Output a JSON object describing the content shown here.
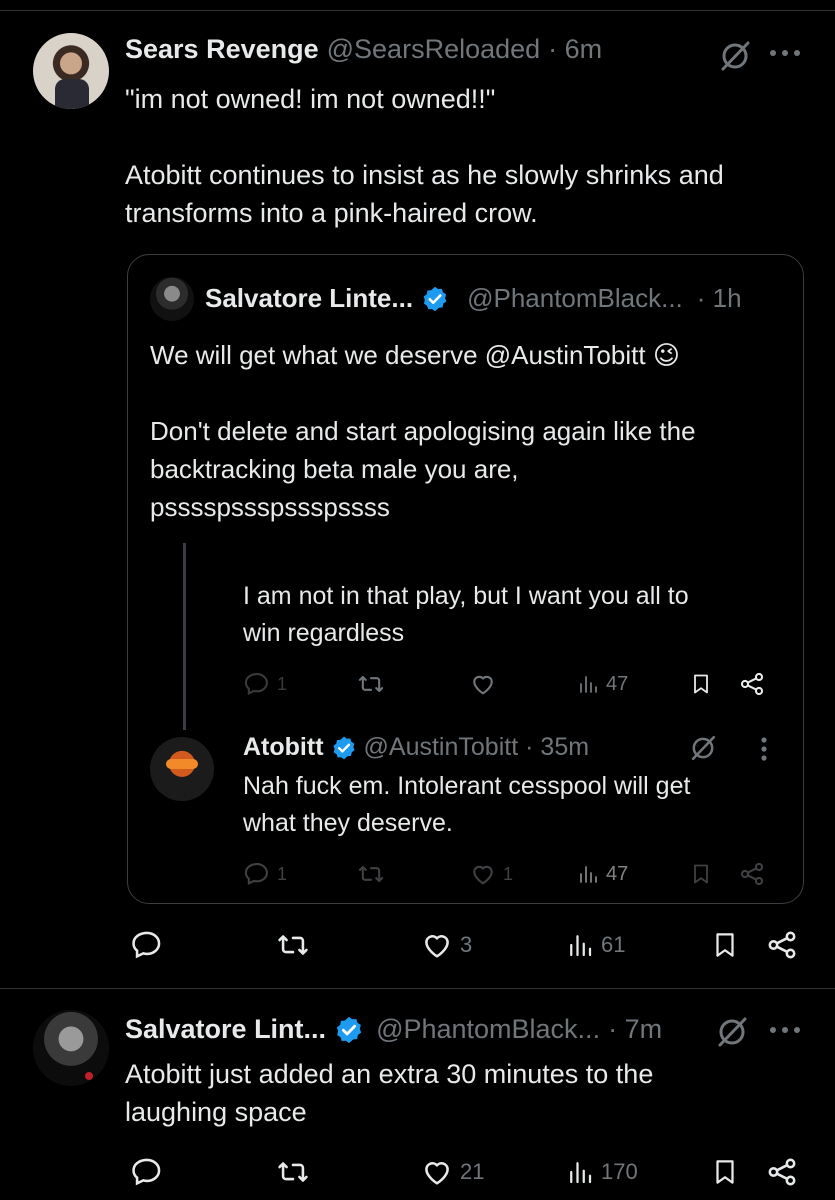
{
  "post1": {
    "display_name": "Sears Revenge",
    "handle": "@SearsReloaded",
    "time": "· 6m",
    "line1": "\"im not owned! im not owned!!\"",
    "line2": "Atobitt continues to insist as he slowly shrinks and",
    "line3": "transforms into a pink-haired crow.",
    "stats": {
      "replies": "",
      "reposts": "",
      "likes": "3",
      "views": "61"
    }
  },
  "quote": {
    "display_name": "Salvatore Linte...",
    "handle": "@PhantomBlack...",
    "time": "· 1h",
    "line1": "We will get what we deserve @AustinTobitt",
    "emoji": "😉",
    "line2": "Don't delete and start apologising again like the",
    "line3": "backtracking beta male you are,",
    "line4": "psssspssspssspssss",
    "nested_reply": {
      "line1": "I am not in that play, but I want you all to",
      "line2": "win regardless",
      "stats": {
        "replies": "1",
        "views": "47"
      }
    },
    "atobitt": {
      "display_name": "Atobitt",
      "handle": "@AustinTobitt",
      "time": "· 35m",
      "line1": "Nah fuck em. Intolerant cesspool will get",
      "line2": "what they deserve.",
      "stats": {
        "replies": "1",
        "likes": "1",
        "views": "47"
      }
    }
  },
  "post2": {
    "display_name": "Salvatore Lint...",
    "handle": "@PhantomBlack...",
    "time": "· 7m",
    "line1": "Atobitt just added an extra 30 minutes to the",
    "line2": "laughing space",
    "stats": {
      "likes": "21",
      "views": "170"
    }
  },
  "colors": {
    "verified": "#1d9bf0",
    "muted": "#71767b",
    "text": "#e7e9ea",
    "border": "#3a3d41"
  }
}
